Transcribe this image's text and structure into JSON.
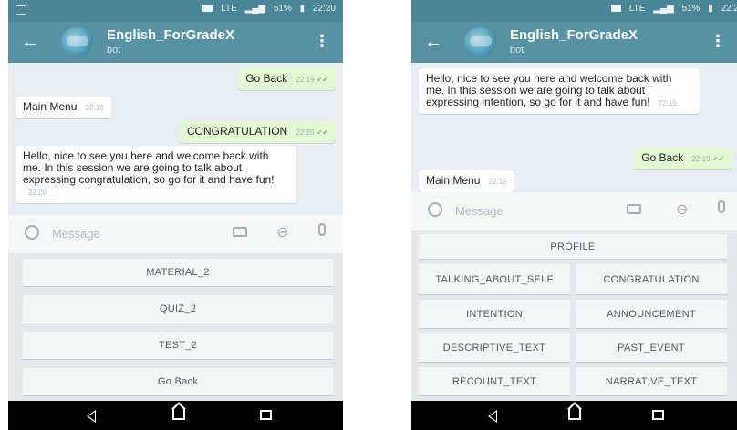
{
  "status_bar": {
    "time_left": "22:20",
    "time_right": "22:2",
    "signal": "LTE",
    "battery": "51%"
  },
  "chat_header": {
    "title": "English_ForGradeX",
    "subtitle": "bot"
  },
  "message_input": {
    "placeholder": "Message"
  },
  "left_screen": {
    "messages": [
      {
        "text": "Go Back",
        "time": "22:19",
        "direction": "out"
      },
      {
        "text": "Main Menu",
        "time": "22:19",
        "direction": "in"
      },
      {
        "text": "CONGRATULATION",
        "time": "22:20",
        "direction": "out"
      },
      {
        "text": "Hello, nice to see you here and welcome back with me. In this session we are going to talk about expressing congratulation, so go for it and have fun!",
        "time": "22:20",
        "direction": "in"
      }
    ],
    "keyboard": [
      "MATERIAL_2",
      "QUIZ_2",
      "TEST_2",
      "Go Back"
    ]
  },
  "right_screen": {
    "messages": [
      {
        "text": "Hello, nice to see you here and welcome back with me. In this session we are going to talk about expressing intention, so go for it and have fun!",
        "time": "22:19",
        "direction": "in"
      },
      {
        "text": "Go Back",
        "time": "22:19",
        "direction": "out"
      },
      {
        "text": "Main Menu",
        "time": "22:19",
        "direction": "in"
      }
    ],
    "keyboard": [
      [
        "PROFILE"
      ],
      [
        "TALKING_ABOUT_SELF",
        "CONGRATULATION"
      ],
      [
        "INTENTION",
        "ANNOUNCEMENT"
      ],
      [
        "DESCRIPTIVE_TEXT",
        "PAST_EVENT"
      ],
      [
        "RECOUNT_TEXT",
        "NARRATIVE_TEXT"
      ]
    ]
  },
  "colors": {
    "header": "#5792a4",
    "status_bar": "#4a8598",
    "outgoing_bubble": "#e4f8d4",
    "chat_bg": "#e7edf0"
  }
}
